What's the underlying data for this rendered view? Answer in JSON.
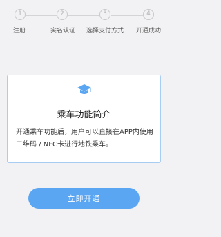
{
  "stepper": {
    "steps": [
      {
        "number": "1",
        "label": "注册"
      },
      {
        "number": "2",
        "label": "实名认证"
      },
      {
        "number": "3",
        "label": "选择支付方式"
      },
      {
        "number": "4",
        "label": "开通成功"
      }
    ]
  },
  "card": {
    "icon": "graduation-cap-icon",
    "title": "乘车功能简介",
    "description": "开通乘车功能后，用户可以直接在APP内使用二维码 / NFC卡进行地铁乘车。"
  },
  "actions": {
    "primary_label": "立即开通"
  },
  "colors": {
    "accent": "#5aa6f2",
    "card_border": "#a8cdf3",
    "step_gray": "#c8c8ca"
  }
}
